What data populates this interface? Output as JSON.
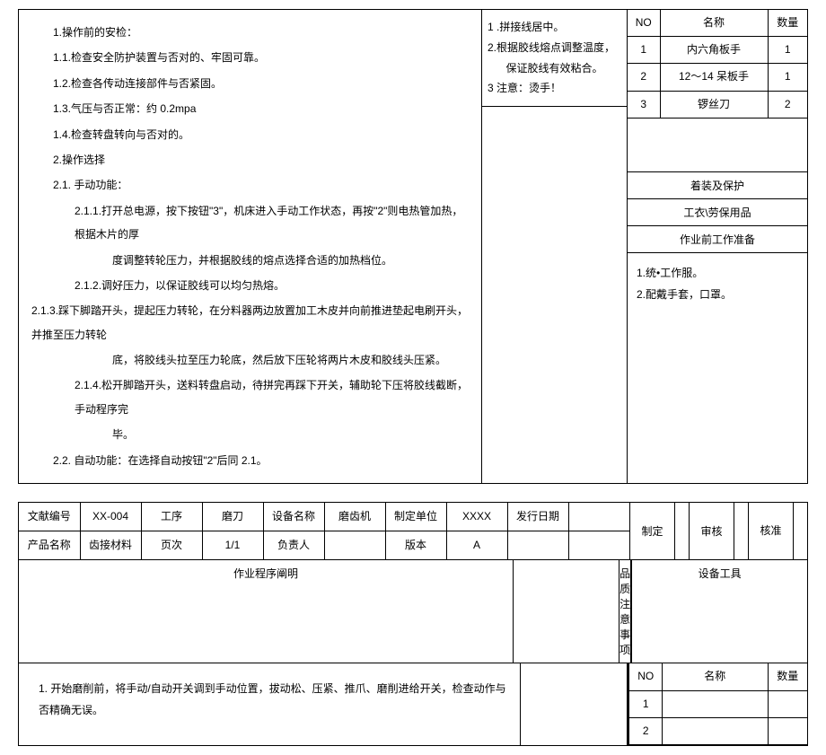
{
  "top": {
    "left": {
      "l1": "1.操作前的安检：",
      "l2": "1.1.检查安全防护装置与否对的、牢固可靠。",
      "l3": "1.2.检查各传动连接部件与否紧固。",
      "l4": "1.3.气压与否正常：约 0.2mpa",
      "l5": "1.4.检查转盘转向与否对的。",
      "l6": "2.操作选择",
      "l7": "2.1.  手动功能：",
      "l8": "2.1.1.打开总电源，按下按钮\"3\"，机床进入手动工作状态，再按\"2\"则电热管加热，根据木片的厚",
      "l8b": "度调整转轮压力，并根据胶线的熔点选择合适的加热档位。",
      "l9": "2.1.2.调好压力，以保证胶线可以均匀热熔。",
      "l10": "2.1.3.踩下脚踏开头，提起压力转轮，在分料器两边放置加工木皮并向前推进垫起电刷开头，并推至压力转轮",
      "l10b": "底，将胶线头拉至压力轮底，然后放下压轮将两片木皮和胶线头压紧。",
      "l11": "2.1.4.松开脚踏开头，送料转盘启动，待拼完再踩下开关，辅助轮下压将胶线截断，手动程序完",
      "l11b": "毕。",
      "l12": "2.2.  自动功能：在选择自动按钮\"2\"后同 2.1。"
    },
    "mid": {
      "m1": "1          .拼接线居中。",
      "m2": "2.根据胶线熔点调整温度，",
      "m2b": "保证胶线有效粘合。",
      "m3": "3          注意：烫手！"
    },
    "tools": {
      "h_no": "NO",
      "h_name": "名称",
      "h_qty": "数量",
      "rows": [
        {
          "no": "1",
          "name": "内六角板手",
          "qty": "1"
        },
        {
          "no": "2",
          "name": "12～14 呆板手",
          "qty": "1"
        },
        {
          "no": "3",
          "name": "锣丝刀",
          "qty": "2"
        }
      ],
      "label_dress": "着装及保护",
      "label_cloth": "工衣\\劳保用品",
      "label_prep": "作业前工作准备",
      "prep1": "1.统•工作服。",
      "prep2": "2.配戴手套，口罩。"
    }
  },
  "bottom": {
    "hdr": {
      "c1": "文献编号",
      "v1": "XX-004",
      "c2": "工序",
      "v2": "磨刀",
      "c3": "设备名称",
      "v3": "磨齿机",
      "c4": "制定单位",
      "v4": "XXXX",
      "c5": "发行日期",
      "v5": "",
      "r2c1": "产品名称",
      "r2v1": "齿接材料",
      "r2c2": "页次",
      "r2v2": "1/1",
      "r2c3": "负责人",
      "r2v3": "",
      "r2c4": "版本",
      "r2v4": "A",
      "make": "制定",
      "check": "审核",
      "approve": "核准"
    },
    "sub": {
      "ops": "作业程序阐明",
      "quality": "品质注意事项",
      "tool": "设备工具"
    },
    "body": {
      "p1": "1. 开始磨削前，将手动/自动开关调到手动位置，拔动松、压紧、推爪、磨削进给开关，检查动作与否精确无误。"
    },
    "tool": {
      "h_no": "NO",
      "h_name": "名称",
      "h_qty": "数量",
      "r1": "1",
      "r2": "2"
    }
  }
}
